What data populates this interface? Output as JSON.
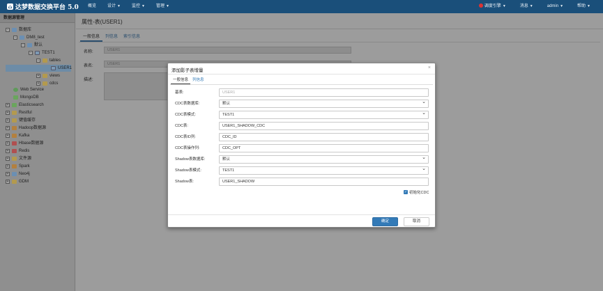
{
  "nav": {
    "brand": "达梦数据交换平台 5.0",
    "menu": [
      {
        "label": "概览"
      },
      {
        "label": "设计"
      },
      {
        "label": "监控"
      },
      {
        "label": "管理"
      }
    ],
    "right": [
      {
        "label": "调度引擎"
      },
      {
        "label": "消息"
      },
      {
        "label": "admin"
      },
      {
        "label": "帮助"
      }
    ]
  },
  "sidebar": {
    "title": "数据源管理",
    "tree": [
      {
        "label": "数据库",
        "toggle": "-"
      },
      {
        "label": "DM8_test",
        "toggle": "-"
      },
      {
        "label": "默认",
        "toggle": "-"
      },
      {
        "label": "TEST1",
        "toggle": "-"
      },
      {
        "label": "tables",
        "toggle": "-"
      },
      {
        "label": "USER1",
        "toggle": ""
      },
      {
        "label": "views",
        "toggle": "+"
      },
      {
        "label": "cdcs",
        "toggle": "+"
      },
      {
        "label": "Web Service",
        "toggle": ""
      },
      {
        "label": "MongoDB",
        "toggle": ""
      },
      {
        "label": "Elasticsearch",
        "toggle": "+"
      },
      {
        "label": "Restful",
        "toggle": "+"
      },
      {
        "label": "键值缓存",
        "toggle": "+"
      },
      {
        "label": "Hadoop数据源",
        "toggle": "+"
      },
      {
        "label": "Kafka",
        "toggle": "+"
      },
      {
        "label": "Hbase数据源",
        "toggle": "+"
      },
      {
        "label": "Redis",
        "toggle": "+"
      },
      {
        "label": "文件源",
        "toggle": "+"
      },
      {
        "label": "Spark",
        "toggle": "+"
      },
      {
        "label": "Neo4j",
        "toggle": "+"
      },
      {
        "label": "GDM",
        "toggle": "+"
      }
    ]
  },
  "main": {
    "title": "属性-表(USER1)",
    "tabs": [
      {
        "label": "一般信息"
      },
      {
        "label": "列信息"
      },
      {
        "label": "索引信息"
      }
    ],
    "fields": [
      {
        "label": "名称:",
        "value": "USER1"
      },
      {
        "label": "表名:",
        "value": "USER1"
      },
      {
        "label": "描述:",
        "value": ""
      }
    ]
  },
  "modal": {
    "title": "添加影子表增量",
    "close": "×",
    "tabs": [
      {
        "label": "一般信息"
      },
      {
        "label": "列信息"
      }
    ],
    "fields": [
      {
        "label": "基表:",
        "value": "USER1"
      },
      {
        "label": "CDC表数据库:",
        "value": "默认"
      },
      {
        "label": "CDC表模式:",
        "value": "TEST1"
      },
      {
        "label": "CDC表:",
        "value": "USER1_SHADOW_CDC"
      },
      {
        "label": "CDC表ID列:",
        "value": "CDC_ID"
      },
      {
        "label": "CDC表操作列:",
        "value": "CDC_OPT"
      },
      {
        "label": "Shadow表数据库:",
        "value": "默认"
      },
      {
        "label": "Shadow表模式:",
        "value": "TEST1"
      },
      {
        "label": "Shadow表:",
        "value": "USER1_SHADOW"
      }
    ],
    "checkbox_label": "初始化CDC",
    "ok": "确定",
    "cancel": "取消"
  }
}
